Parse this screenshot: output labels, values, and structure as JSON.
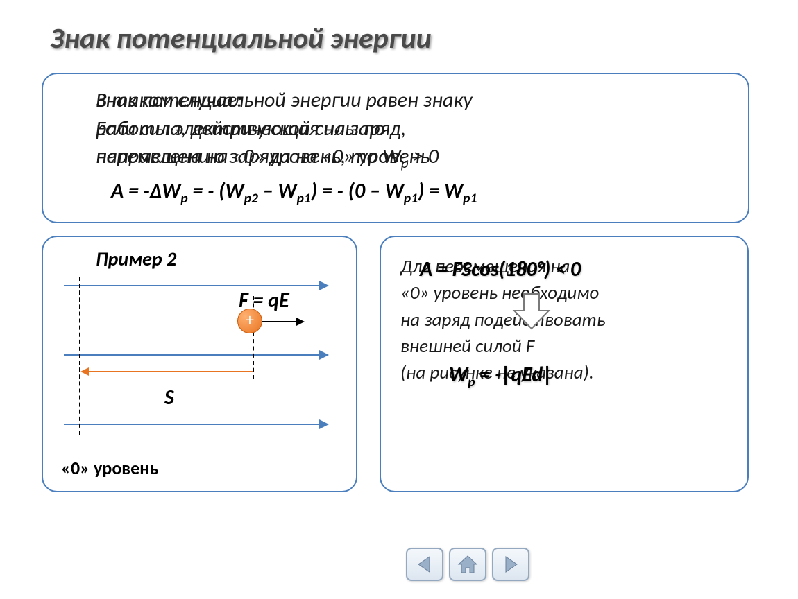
{
  "title": "Знак потенциальной энергии",
  "topBox": {
    "layer1_line1": "Знак потенциальной энергии равен знаку",
    "layer1_line2": "работы электрической силы по",
    "layer1_line3": "перемещению заряда на «0» уровень",
    "layer2_line1": "В таком случае:",
    "layer2_line2": "Если сила, действующая на заряд,",
    "layer2_line3": "направлена на «0» уровень, то W",
    "layer2_sub": "p",
    "layer2_tail": " > 0",
    "formula_html": "A = -ΔW<span class='sub'>p</span> = - (W<span class='sub'>p2</span> – W<span class='sub'>p1</span>) = - (0 – W<span class='sub'>p1</span>) = W<span class='sub'>p1</span>"
  },
  "example": {
    "title": "Пример 2",
    "force_label": "F = qE",
    "s_label": "S",
    "charge_symbol": "+",
    "zero_level": "«0» уровень"
  },
  "rightBox": {
    "formula1_html": "A = FScos(180°) < 0",
    "formula2_html": "W<span class='sub'>p</span> = -|qEd|",
    "text_line1": "Для перемещения на",
    "text_line2": "«0» уровень необходимо",
    "text_line3": "на заряд подействовать",
    "text_line4": "внешней силой F",
    "text_line5": "(на рисунке не указана)."
  },
  "nav": {
    "prev": "previous",
    "home": "home",
    "next": "next"
  }
}
